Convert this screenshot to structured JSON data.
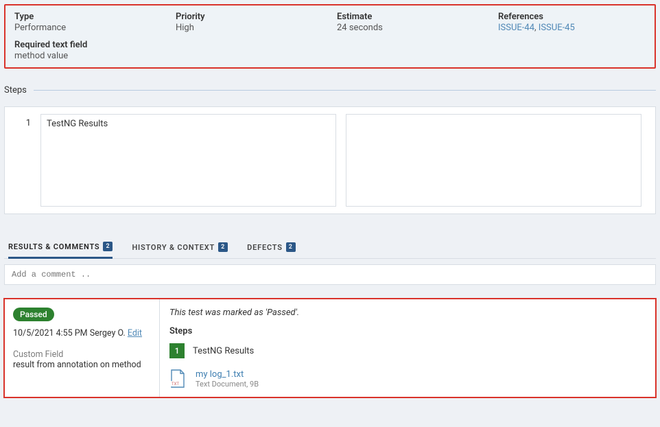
{
  "details": {
    "type": {
      "label": "Type",
      "value": "Performance"
    },
    "priority": {
      "label": "Priority",
      "value": "High"
    },
    "estimate": {
      "label": "Estimate",
      "value": "24 seconds"
    },
    "references": {
      "label": "References",
      "link1": "ISSUE-44",
      "link2": "ISSUE-45",
      "sep": ", "
    },
    "required": {
      "label": "Required text field",
      "value": "method value"
    }
  },
  "steps_section": {
    "title": "Steps",
    "items": [
      {
        "num": "1",
        "left": "TestNG Results",
        "right": ""
      }
    ]
  },
  "tabs": {
    "results": {
      "label": "RESULTS & COMMENTS",
      "count": "2"
    },
    "history": {
      "label": "HISTORY & CONTEXT",
      "count": "2"
    },
    "defects": {
      "label": "DEFECTS",
      "count": "2"
    }
  },
  "comment_placeholder": "Add a comment ..",
  "result": {
    "status": "Passed",
    "datetime": "10/5/2021 4:55 PM",
    "author": "Sergey O.",
    "edit": "Edit",
    "custom_field_label": "Custom Field",
    "custom_field_value": "result from annotation on method",
    "message": "This test was marked as 'Passed'.",
    "steps_title": "Steps",
    "step_badge": "1",
    "step_text": "TestNG Results",
    "attachment": {
      "name": "my log_1.txt",
      "meta": "Text Document, 9B"
    }
  }
}
